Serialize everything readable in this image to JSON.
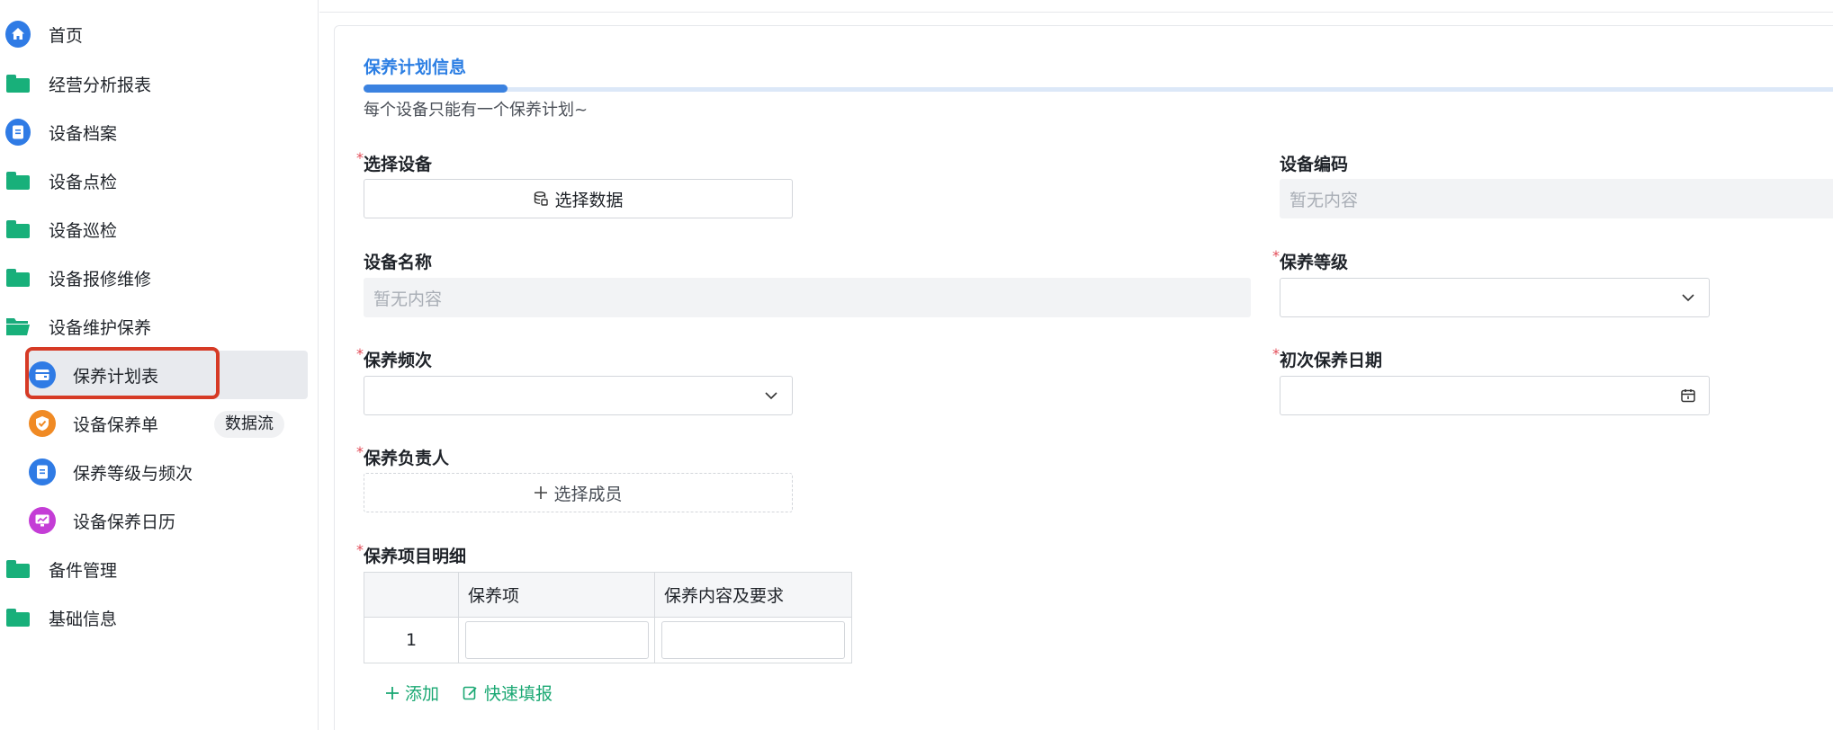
{
  "sidebar": {
    "items": [
      {
        "label": "首页",
        "icon": "home-icon"
      },
      {
        "label": "经营分析报表",
        "icon": "folder-icon"
      },
      {
        "label": "设备档案",
        "icon": "document-icon"
      },
      {
        "label": "设备点检",
        "icon": "folder-icon"
      },
      {
        "label": "设备巡检",
        "icon": "folder-icon"
      },
      {
        "label": "设备报修维修",
        "icon": "folder-icon"
      },
      {
        "label": "设备维护保养",
        "icon": "folder-open-icon"
      }
    ],
    "sub_items": [
      {
        "label": "保养计划表",
        "icon": "wallet-icon"
      },
      {
        "label": "设备保养单",
        "icon": "shield-check-icon",
        "tag": "数据流"
      },
      {
        "label": "保养等级与频次",
        "icon": "document-icon"
      },
      {
        "label": "设备保养日历",
        "icon": "chart-icon"
      }
    ],
    "bottom_items": [
      {
        "label": "备件管理",
        "icon": "folder-icon"
      },
      {
        "label": "基础信息",
        "icon": "folder-icon"
      }
    ]
  },
  "form": {
    "section_title": "保养计划信息",
    "hint": "每个设备只能有一个保养计划~",
    "select_device_label": "选择设备",
    "select_device_button": "选择数据",
    "device_code_label": "设备编码",
    "device_code_value": "暂无内容",
    "device_name_label": "设备名称",
    "device_name_value": "暂无内容",
    "level_label": "保养等级",
    "frequency_label": "保养频次",
    "first_date_label": "初次保养日期",
    "owner_label": "保养负责人",
    "owner_button": "选择成员",
    "detail_label": "保养项目明细",
    "required_mark": "*",
    "table": {
      "columns": [
        "保养项",
        "保养内容及要求"
      ],
      "rows": [
        {
          "index": "1"
        }
      ]
    },
    "add_label": "添加",
    "quick_fill_label": "快速填报"
  },
  "colors": {
    "accent": "#2b7ee3",
    "green": "#1aa873",
    "highlight": "#d63a25"
  }
}
